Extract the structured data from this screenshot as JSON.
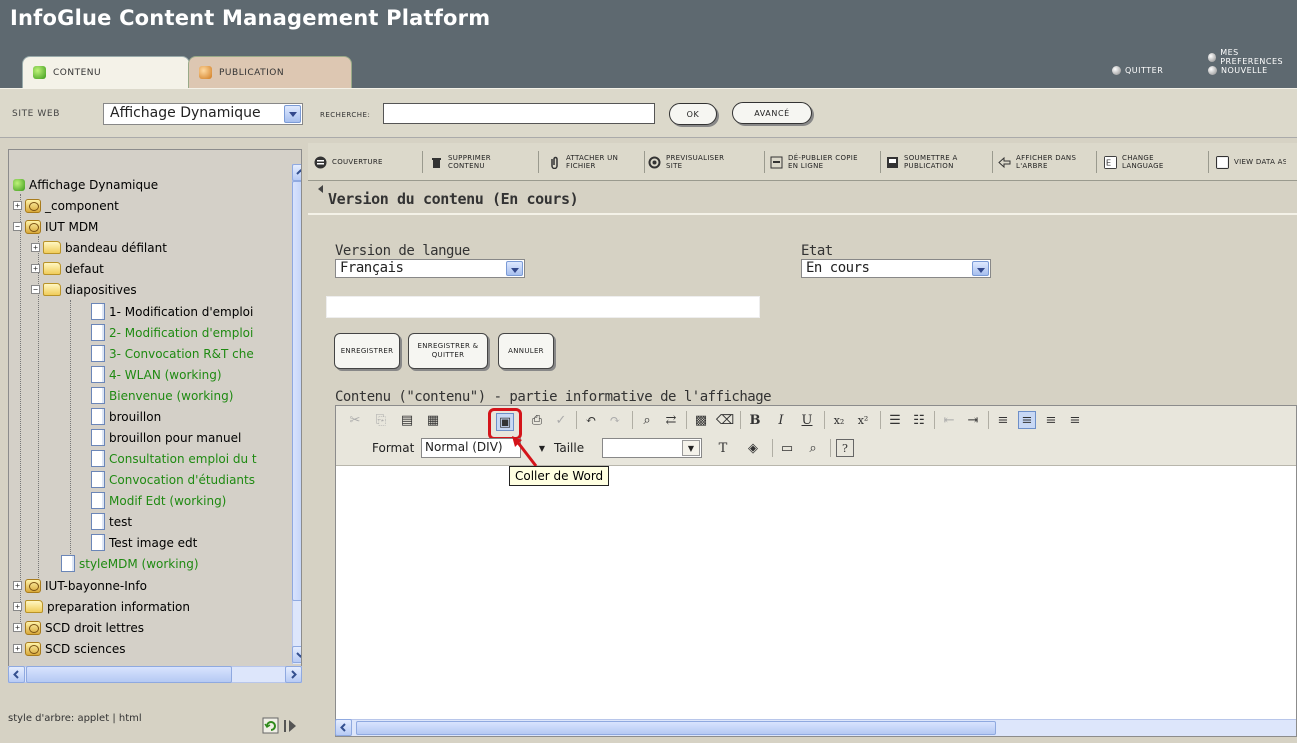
{
  "app": {
    "title": "InfoGlue Content Management Platform"
  },
  "tabs": [
    {
      "label": "CONTENU"
    },
    {
      "label": "PUBLICATION"
    }
  ],
  "header_links": {
    "prefs": "MES PREFERENCES",
    "quitter": "QUITTER",
    "nouvelle": "NOUVELLE"
  },
  "sitebar": {
    "site_label": "SITE WEB",
    "site_value": "Affichage Dynamique",
    "search_label": "RECHERCHE:",
    "search_value": "",
    "ok_label": "OK",
    "avance_label": "AVANCÉ"
  },
  "tree": {
    "items": [
      {
        "label": "Affichage Dynamique",
        "type": "root",
        "green": false
      },
      {
        "label": "_component",
        "type": "repo",
        "green": false
      },
      {
        "label": "IUT MDM",
        "type": "repo",
        "green": false
      },
      {
        "label": "bandeau défilant",
        "type": "folder",
        "green": false
      },
      {
        "label": "defaut",
        "type": "folder",
        "green": false
      },
      {
        "label": "diapositives",
        "type": "folder",
        "green": false
      },
      {
        "label": "1- Modification d'emploi",
        "type": "doc",
        "green": false
      },
      {
        "label": "2- Modification d'emploi",
        "type": "doc",
        "green": true
      },
      {
        "label": "3- Convocation R&T che",
        "type": "doc",
        "green": true
      },
      {
        "label": "4- WLAN (working)",
        "type": "doc",
        "green": true
      },
      {
        "label": "Bienvenue (working)",
        "type": "doc",
        "green": true
      },
      {
        "label": "brouillon",
        "type": "doc",
        "green": false
      },
      {
        "label": "brouillon pour manuel",
        "type": "doc",
        "green": false
      },
      {
        "label": "Consultation emploi du t",
        "type": "doc",
        "green": true
      },
      {
        "label": "Convocation d'étudiants",
        "type": "doc",
        "green": true
      },
      {
        "label": "Modif Edt (working)",
        "type": "doc",
        "green": true
      },
      {
        "label": "test",
        "type": "doc",
        "green": false
      },
      {
        "label": "Test image edt",
        "type": "doc",
        "green": false
      },
      {
        "label": "styleMDM (working)",
        "type": "doc",
        "green": true
      },
      {
        "label": "IUT-bayonne-Info",
        "type": "repo",
        "green": false
      },
      {
        "label": "preparation information",
        "type": "folder",
        "green": false
      },
      {
        "label": "SCD droit lettres",
        "type": "repo",
        "green": false
      },
      {
        "label": "SCD sciences",
        "type": "repo",
        "green": false
      }
    ],
    "style_label": "style d'arbre:",
    "style_applet": "applet",
    "style_html": "html"
  },
  "toolbar": {
    "couverture": "COUVERTURE",
    "supprimer": "SUPPRIMER CONTENU",
    "attacher": "ATTACHER UN FICHIER",
    "previsualiser": "PREVISUALISER SITE",
    "depublier": "DÉ-PUBLIER COPIE EN LIGNE",
    "soumettre": "SOUMETTRE A PUBLICATION",
    "afficher": "AFFICHER DANS L'ARBRE",
    "change_language": "CHANGE LANGUAGE",
    "view_xml": "VIEW DATA AS XML"
  },
  "section": {
    "title": "Version du contenu (En cours)"
  },
  "form": {
    "langue_label": "Version de langue",
    "langue_value": "Français",
    "etat_label": "Etat",
    "etat_value": "En cours",
    "enregistrer": "ENREGISTRER",
    "enregistrer_quitter": "ENREGISTRER & QUITTER",
    "annuler": "ANNULER",
    "contenu_label": "Contenu (\"contenu\") - partie informative de l'affichage"
  },
  "editor": {
    "format_label": "Format",
    "format_value": "Normal (DIV)",
    "taille_label": "Taille",
    "tooltip": "Coller de Word"
  }
}
